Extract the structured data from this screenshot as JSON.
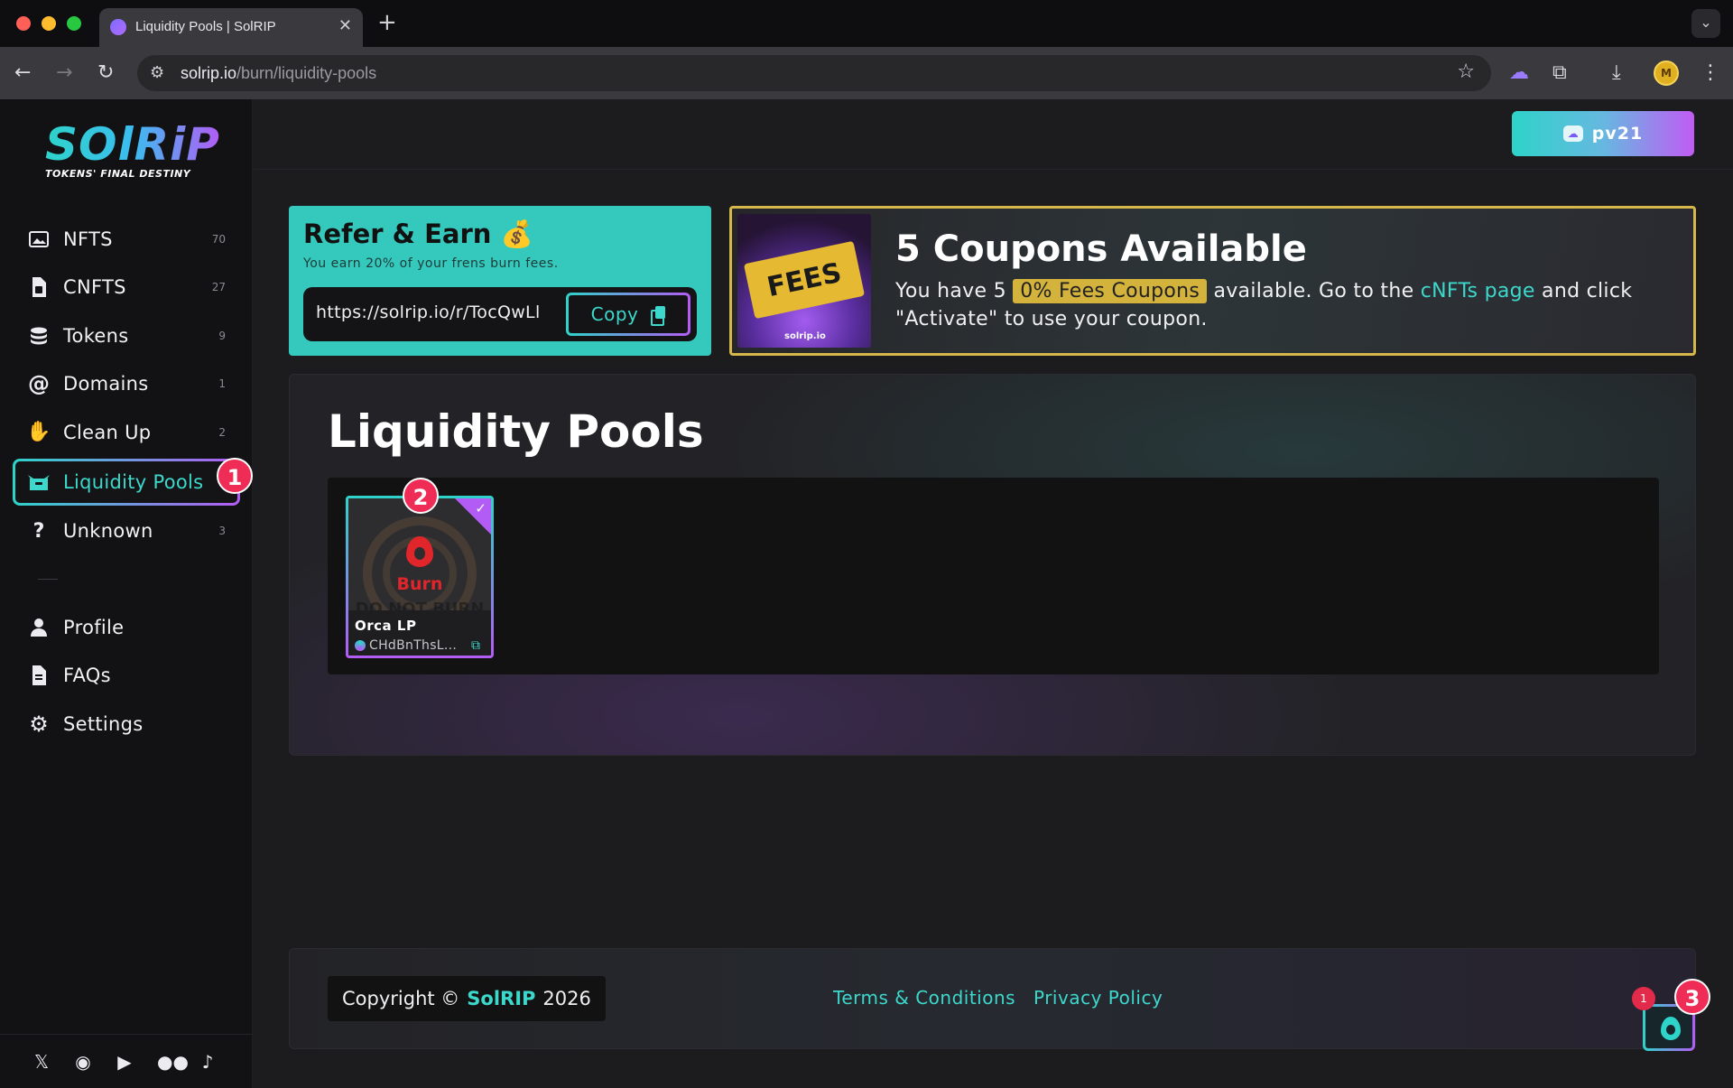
{
  "browser": {
    "tab_title": "Liquidity Pools | SolRIP",
    "url_host": "solrip.io",
    "url_path": "/burn/liquidity-pools",
    "profile_badge": "M"
  },
  "brand": {
    "logo_text": "SOlRiP",
    "tagline": "TOKENS' FINAL DESTINY"
  },
  "sidebar": {
    "items": [
      {
        "label": "NFTS",
        "count": "70",
        "icon": "image-icon"
      },
      {
        "label": "CNFTS",
        "count": "27",
        "icon": "document-icon"
      },
      {
        "label": "Tokens",
        "count": "9",
        "icon": "coins-icon"
      },
      {
        "label": "Domains",
        "count": "1",
        "icon": "at-icon"
      },
      {
        "label": "Clean Up",
        "count": "2",
        "icon": "hand-icon"
      },
      {
        "label": "Liquidity Pools",
        "count": "",
        "icon": "box-icon"
      },
      {
        "label": "Unknown",
        "count": "3",
        "icon": "question-icon"
      }
    ],
    "secondary": [
      {
        "label": "Profile",
        "icon": "user-icon"
      },
      {
        "label": "FAQs",
        "icon": "file-icon"
      },
      {
        "label": "Settings",
        "icon": "gear-icon"
      }
    ],
    "social": [
      "x-icon",
      "discord-icon",
      "youtube-icon",
      "medium-icon",
      "tiktok-icon"
    ]
  },
  "wallet": {
    "name": "pv21"
  },
  "refer": {
    "title": "Refer & Earn 💰",
    "subtitle": "You earn 20% of your frens burn fees.",
    "link": "https://solrip.io/r/TocQwLl",
    "copy_label": "Copy"
  },
  "coupon": {
    "image_text": "FEES",
    "image_brand": "solrip.io",
    "title": "5 Coupons Available",
    "body_prefix": "You have 5 ",
    "highlight": "0% Fees Coupons",
    "body_mid": " available. Go to the ",
    "link_text": "cNFTs page",
    "body_suffix": " and click \"Activate\" to use your coupon."
  },
  "main": {
    "title": "Liquidity Pools",
    "pools": [
      {
        "name": "Orca LP",
        "address": "CHdBnThsL...",
        "image_label": "Burn",
        "image_watermark": "DO NOT BURN",
        "selected": true
      }
    ]
  },
  "footer": {
    "copyright_prefix": "Copyright ©",
    "brand": "SolRIP",
    "year": "2026",
    "terms": "Terms & Conditions",
    "privacy": "Privacy Policy",
    "fab_badge": "1"
  },
  "markers": [
    "1",
    "2",
    "3"
  ],
  "colors": {
    "accent_teal": "#2ed3c9",
    "accent_purple": "#b35cf5",
    "coupon_gold": "#d5b74a",
    "marker_red": "#ee2c55"
  }
}
